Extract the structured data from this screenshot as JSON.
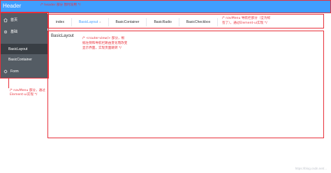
{
  "header": {
    "title": "Header",
    "annotation": "/* header 部分 暂时没用 */"
  },
  "sidebar": {
    "items": [
      {
        "icon": "home-icon",
        "label": "首页"
      },
      {
        "icon": "gear-icon",
        "label": "基础"
      },
      {
        "icon": "",
        "label": "BasicLayout"
      },
      {
        "icon": "",
        "label": "BasicContainer"
      },
      {
        "icon": "settings-icon",
        "label": "Form"
      }
    ],
    "annotation_line1": "/* navMenu 部分，通过",
    "annotation_line2": "Element-ui实现 */"
  },
  "tabs": {
    "items": [
      {
        "label": "index"
      },
      {
        "label": "BasicLayout",
        "close": "×"
      },
      {
        "label": "BasicContainer"
      },
      {
        "label": "BasicRadio"
      },
      {
        "label": "BasicCheckbox"
      }
    ],
    "annotation_line1": "/* navMenu 导航栏部分（全为标",
    "annotation_line2": "签了），通过Element-ui实现 */"
  },
  "content": {
    "title": "BasicLayout",
    "annotation_line1": "/* <router-view/> 部分，根",
    "annotation_line2": "据左侧和导航栏路由变化而改变",
    "annotation_line3": "显示界面，实现页面跳转 */"
  },
  "watermark": "https://blog.csdn.net/...",
  "colors": {
    "accent": "#409eff",
    "sidebar_bg": "#545c64",
    "annotation_red": "#e8303a"
  }
}
